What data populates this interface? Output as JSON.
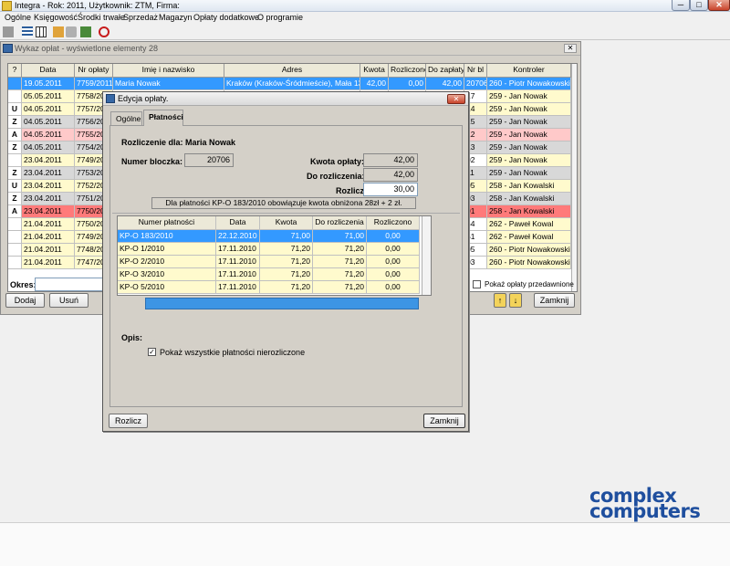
{
  "app": {
    "title": "Integra  -  Rok: 2011, Użytkownik: ZTM, Firma:",
    "window_controls": [
      "─",
      "□",
      "✕"
    ]
  },
  "menu": [
    "Ogólne",
    "Księgowość",
    "Środki trwałe",
    "Sprzedaż",
    "Magazyn",
    "Opłaty dodatkowe",
    "O programie"
  ],
  "list_window": {
    "title": "Wykaz opłat - wyświetlone elementy 28",
    "columns": [
      "?",
      "Data",
      "Nr opłaty",
      "Imię i nazwisko",
      "Adres",
      "Kwota",
      "Rozliczono",
      "Do zapłaty",
      "Nr bl",
      "Kontroler"
    ],
    "rows": [
      {
        "flag": "",
        "date": "19.05.2011",
        "nr": "7759/2011",
        "name": "Maria Nowak",
        "addr": "Kraków (Kraków-Śródmieście), Mała 13",
        "kwota": "42,00",
        "rozl": "0,00",
        "dozap": "42,00",
        "nrbl": "20706",
        "kontroler": "260 - Piotr Nowakowski",
        "style": "selected"
      },
      {
        "flag": "",
        "date": "05.05.2011",
        "nr": "7758/2011",
        "nrbl": "17",
        "kontroler": "259 - Jan Nowak",
        "style": "white"
      },
      {
        "flag": "U",
        "date": "04.05.2011",
        "nr": "7757/2011",
        "nrbl": "14",
        "kontroler": "259 - Jan Nowak",
        "style": "yellow"
      },
      {
        "flag": "Z",
        "date": "04.05.2011",
        "nr": "7756/2011",
        "nrbl": "15",
        "kontroler": "259 - Jan Nowak",
        "style": "gray"
      },
      {
        "flag": "A",
        "date": "04.05.2011",
        "nr": "7755/2011",
        "nrbl": "12",
        "kontroler": "259 - Jan Nowak",
        "style": "red"
      },
      {
        "flag": "Z",
        "date": "04.05.2011",
        "nr": "7754/2011",
        "nrbl": "13",
        "kontroler": "259 - Jan Nowak",
        "style": "gray"
      },
      {
        "flag": "",
        "date": "23.04.2011",
        "nr": "7749/2011",
        "nrbl": "02",
        "kontroler": "259 - Jan Nowak",
        "style": "white"
      },
      {
        "flag": "Z",
        "date": "23.04.2011",
        "nr": "7753/2011",
        "nrbl": "11",
        "kontroler": "259 - Jan Nowak",
        "style": "gray"
      },
      {
        "flag": "U",
        "date": "23.04.2011",
        "nr": "7752/2011",
        "nrbl": "05",
        "kontroler": "258 - Jan Kowalski",
        "style": "yellow"
      },
      {
        "flag": "Z",
        "date": "23.04.2011",
        "nr": "7751/2011",
        "nrbl": "03",
        "kontroler": "258 - Jan Kowalski",
        "style": "gray"
      },
      {
        "flag": "A",
        "date": "23.04.2011",
        "nr": "7750/2011",
        "nrbl": "01",
        "kontroler": "258 - Jan Kowalski",
        "style": "redstrong"
      },
      {
        "flag": "",
        "date": "21.04.2011",
        "nr": "7750/2011",
        "nrbl": "54",
        "kontroler": "262 - Paweł Kowal",
        "style": "white"
      },
      {
        "flag": "",
        "date": "21.04.2011",
        "nr": "7749/2011",
        "nrbl": "51",
        "kontroler": "262 - Paweł Kowal",
        "style": "white"
      },
      {
        "flag": "",
        "date": "21.04.2011",
        "nr": "7748/2011",
        "nrbl": "05",
        "kontroler": "260 - Piotr Nowakowski",
        "style": "white"
      },
      {
        "flag": "",
        "date": "21.04.2011",
        "nr": "7747/2011",
        "nrbl": "03",
        "kontroler": "260 - Piotr Nowakowski",
        "style": "white"
      }
    ],
    "okres_label": "Okres:",
    "buttons": {
      "dodaj": "Dodaj",
      "usun": "Usuń",
      "zamknij": "Zamknij",
      "j": "j"
    },
    "checkbox_label": "Pokaż opłaty przedawnione"
  },
  "dialog": {
    "title": "Edycja opłaty.",
    "tabs": [
      "Ogólne",
      "Płatności"
    ],
    "rozliczenie_label": "Rozliczenie dla: Maria Nowak",
    "numer_bloczka_label": "Numer bloczka:",
    "numer_bloczka": "20706",
    "kwota_oplaty_label": "Kwota opłaty:",
    "kwota_oplaty": "42,00",
    "do_rozliczenia_label": "Do rozliczenia:",
    "do_rozliczenia": "42,00",
    "rozlicz_label": "Rozlicz:",
    "rozlicz": "30,00",
    "info": "Dla płatności KP-O 183/2010 obowiązuje kwota obniżona 28zł + 2 zł.",
    "columns": [
      "Numer płatności",
      "Data",
      "Kwota",
      "Do rozliczenia",
      "Rozliczono"
    ],
    "payments": [
      [
        "KP-O 183/2010",
        "22.12.2010",
        "71,00",
        "71,00",
        "0,00"
      ],
      [
        "KP-O 1/2010",
        "17.11.2010",
        "71,20",
        "71,20",
        "0,00"
      ],
      [
        "KP-O 2/2010",
        "17.11.2010",
        "71,20",
        "71,20",
        "0,00"
      ],
      [
        "KP-O 3/2010",
        "17.11.2010",
        "71,20",
        "71,20",
        "0,00"
      ],
      [
        "KP-O 5/2010",
        "17.11.2010",
        "71,20",
        "71,20",
        "0,00"
      ]
    ],
    "opis_label": "Opis:",
    "show_all_label": "Pokaż wszystkie płatności nierozliczone",
    "rozlicz_button": "Rozlicz",
    "zamknij_button": "Zamknij"
  },
  "logo": {
    "line1": "complex",
    "line2": "computers"
  },
  "colors": {
    "selected": "#3399ff",
    "yellow": "#fffacd",
    "gray": "#d8d8d8",
    "red": "#ffc9c9",
    "redstrong": "#ff7a7a"
  }
}
